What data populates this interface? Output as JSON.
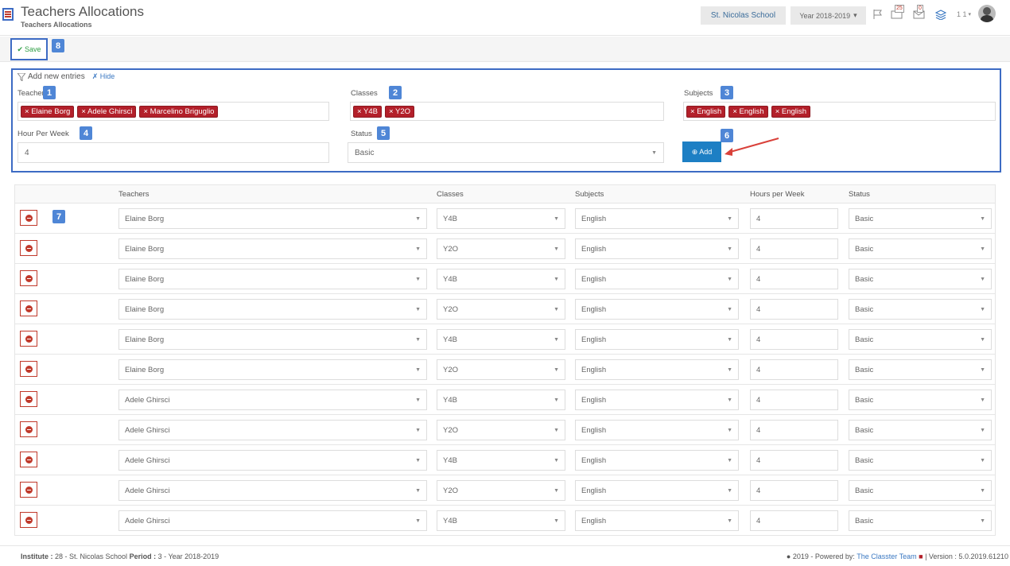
{
  "header": {
    "title": "Teachers Allocations",
    "subtitle": "Teachers Allocations",
    "school": "St. Nicolas School",
    "year": "Year 2018-2019",
    "messages_count": "25",
    "alerts_count": "0",
    "user_count": "1 1"
  },
  "toolbar": {
    "save_label": "Save",
    "callout": "8"
  },
  "entries": {
    "heading": "Add new entries",
    "hide_label": "Hide",
    "teachers_label": "Teachers",
    "teachers_callout": "1",
    "teachers": [
      "Elaine Borg",
      "Adele Ghirsci",
      "Marcelino Briguglio"
    ],
    "classes_label": "Classes",
    "classes_callout": "2",
    "classes": [
      "Y4B",
      "Y2O"
    ],
    "subjects_label": "Subjects",
    "subjects_callout": "3",
    "subjects": [
      "English",
      "English",
      "English"
    ],
    "hours_label": "Hour Per Week",
    "hours_callout": "4",
    "hours_value": "4",
    "status_label": "Status",
    "status_callout": "5",
    "status_value": "Basic",
    "add_label": "Add",
    "add_callout": "6"
  },
  "grid": {
    "callout": "7",
    "headers": [
      "Teachers",
      "Classes",
      "Subjects",
      "Hours per Week",
      "Status"
    ],
    "rows": [
      {
        "teacher": "Elaine Borg",
        "class": "Y4B",
        "subject": "English",
        "hours": "4",
        "status": "Basic"
      },
      {
        "teacher": "Elaine Borg",
        "class": "Y2O",
        "subject": "English",
        "hours": "4",
        "status": "Basic"
      },
      {
        "teacher": "Elaine Borg",
        "class": "Y4B",
        "subject": "English",
        "hours": "4",
        "status": "Basic"
      },
      {
        "teacher": "Elaine Borg",
        "class": "Y2O",
        "subject": "English",
        "hours": "4",
        "status": "Basic"
      },
      {
        "teacher": "Elaine Borg",
        "class": "Y4B",
        "subject": "English",
        "hours": "4",
        "status": "Basic"
      },
      {
        "teacher": "Elaine Borg",
        "class": "Y2O",
        "subject": "English",
        "hours": "4",
        "status": "Basic"
      },
      {
        "teacher": "Adele Ghirsci",
        "class": "Y4B",
        "subject": "English",
        "hours": "4",
        "status": "Basic"
      },
      {
        "teacher": "Adele Ghirsci",
        "class": "Y2O",
        "subject": "English",
        "hours": "4",
        "status": "Basic"
      },
      {
        "teacher": "Adele Ghirsci",
        "class": "Y4B",
        "subject": "English",
        "hours": "4",
        "status": "Basic"
      },
      {
        "teacher": "Adele Ghirsci",
        "class": "Y2O",
        "subject": "English",
        "hours": "4",
        "status": "Basic"
      },
      {
        "teacher": "Adele Ghirsci",
        "class": "Y4B",
        "subject": "English",
        "hours": "4",
        "status": "Basic"
      }
    ]
  },
  "footer": {
    "institute_label": "Institute :",
    "institute_value": "28 - St. Nicolas School",
    "period_label": "Period :",
    "period_value": "3 - Year 2018-2019",
    "copyright": "2019 - Powered by:",
    "team_link": "The Classter Team",
    "version": "| Version : 5.0.2019.61210"
  },
  "colors": {
    "accent": "#3d6bc4",
    "tag": "#b3202a",
    "add_button": "#1d7fc4",
    "save": "#2e9e44"
  }
}
